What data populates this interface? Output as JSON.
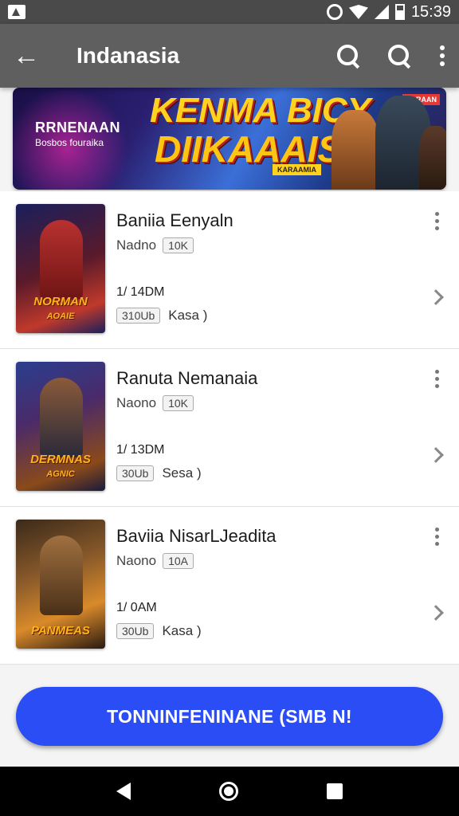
{
  "status_bar": {
    "time": "15:39"
  },
  "app_bar": {
    "title": "Indanasia"
  },
  "banner": {
    "subtitle_line1": "RRNENAAN",
    "subtitle_line2": "Bosbos fouraika",
    "title_line1": "KENMA BICY",
    "title_line2": "DIIKAAAISS",
    "tag": "KARAAMIA",
    "corner_tag": "KARAAN"
  },
  "games": [
    {
      "name": "Baniia Eenyaln",
      "developer": "Nadno",
      "rating_badge": "10K",
      "size": "1/ 14DM",
      "version_badge": "310Ub",
      "category": "Kasa )",
      "cover_label_line1": "NORMAN",
      "cover_label_line2": "AOAIE"
    },
    {
      "name": "Ranuta Nemanaia",
      "developer": "Naono",
      "rating_badge": "10K",
      "size": "1/ 13DM",
      "version_badge": "30Ub",
      "category": "Sesa )",
      "cover_label_line1": "DERMNAS",
      "cover_label_line2": "AGNIC"
    },
    {
      "name": "Baviia NisarLJeadita",
      "developer": "Naono",
      "rating_badge": "10A",
      "size": "1/ 0AM",
      "version_badge": "30Ub",
      "category": "Kasa )",
      "cover_label_line1": "PANMEAS",
      "cover_label_line2": ""
    }
  ],
  "cta": {
    "label": "TONNINFENINANE (SMB N!"
  },
  "colors": {
    "accent": "#2a4df5",
    "app_bar": "#5f5f5f",
    "status_bar": "#4a4a4a"
  }
}
